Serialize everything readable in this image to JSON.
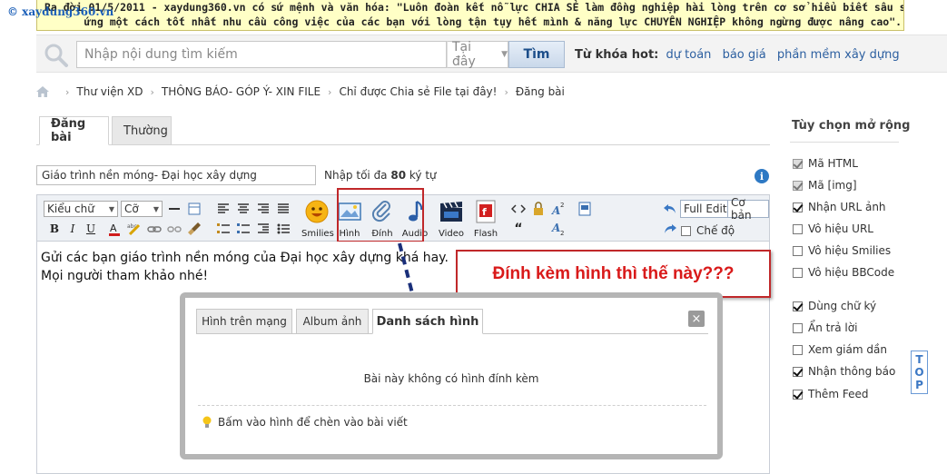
{
  "watermark": "© xaydung360.vn",
  "banner": {
    "line1": "Ra đời 01/5/2011 - xaydung360.vn có sứ mệnh và văn hóa: \"Luôn đoàn kết nỗ lực CHIA SẺ làm đồng nghiệp hài lòng trên cơ sở hiểu biết sâu sắc & đáp",
    "line2": "ứng một cách tốt nhất nhu cầu công việc của các bạn với lòng tận tụy hết mình & năng lực CHUYÊN NGHIỆP không ngừng được nâng cao\"."
  },
  "search": {
    "placeholder": "Nhập nội dung tìm kiếm",
    "scope": "Tại đây",
    "button": "Tìm",
    "hot_label": "Từ khóa hot:",
    "hot_keywords": [
      "dự toán",
      "báo giá",
      "phần mềm xây dựng"
    ]
  },
  "breadcrumb": [
    "Thư viện XD",
    "THÔNG BÁO- GÓP Ý- XIN FILE",
    "Chỉ được Chia sẻ File tại đây!",
    "Đăng bài"
  ],
  "tabs": {
    "post": "Đăng bài",
    "normal": "Thường"
  },
  "title_field": {
    "value": "Giáo trình nền móng- Đại học xây dựng",
    "hint_prefix": "Nhập tối đa ",
    "hint_max": "80",
    "hint_suffix": " ký tự"
  },
  "toolbar": {
    "font_select": "Kiểu chữ",
    "size_select": "Cỡ",
    "smilies": "Smilies",
    "image": "Hình",
    "attach": "Đính",
    "audio": "Audio",
    "video": "Video",
    "flash": "Flash",
    "full_edit": "Full Edit",
    "basic": "Cơ bản",
    "mode": "Chế độ"
  },
  "editor": {
    "line1": "Gửi các bạn giáo trình nền móng của Đại học xây dựng khá hay.",
    "line2": "Mọi người tham khảo nhé!"
  },
  "callout": "Đính kèm hình thì  thế này???",
  "dialog": {
    "tabs": [
      "Hình trên mạng",
      "Album ảnh",
      "Danh sách hình"
    ],
    "close": "×",
    "empty": "Bài này không có hình đính kèm",
    "tip": "Bấm vào hình để chèn vào bài viết"
  },
  "sidebar": {
    "title": "Tùy chọn mở rộng",
    "options": [
      {
        "label": "Mã HTML",
        "checked": true,
        "disabled": true
      },
      {
        "label": "Mã [img]",
        "checked": true,
        "disabled": true
      },
      {
        "label": "Nhận URL ảnh",
        "checked": true,
        "disabled": false
      },
      {
        "label": "Vô hiệu URL",
        "checked": false,
        "disabled": false
      },
      {
        "label": "Vô hiệu Smilies",
        "checked": false,
        "disabled": false
      },
      {
        "label": "Vô hiệu BBCode",
        "checked": false,
        "disabled": false
      },
      {
        "label": "Dùng chữ ký",
        "checked": true,
        "disabled": false
      },
      {
        "label": "Ẩn trả lời",
        "checked": false,
        "disabled": false
      },
      {
        "label": "Xem giám dần",
        "checked": false,
        "disabled": false
      },
      {
        "label": "Nhận thông báo",
        "checked": true,
        "disabled": false
      },
      {
        "label": "Thêm Feed",
        "checked": true,
        "disabled": false
      }
    ],
    "top_button": "TOP"
  }
}
